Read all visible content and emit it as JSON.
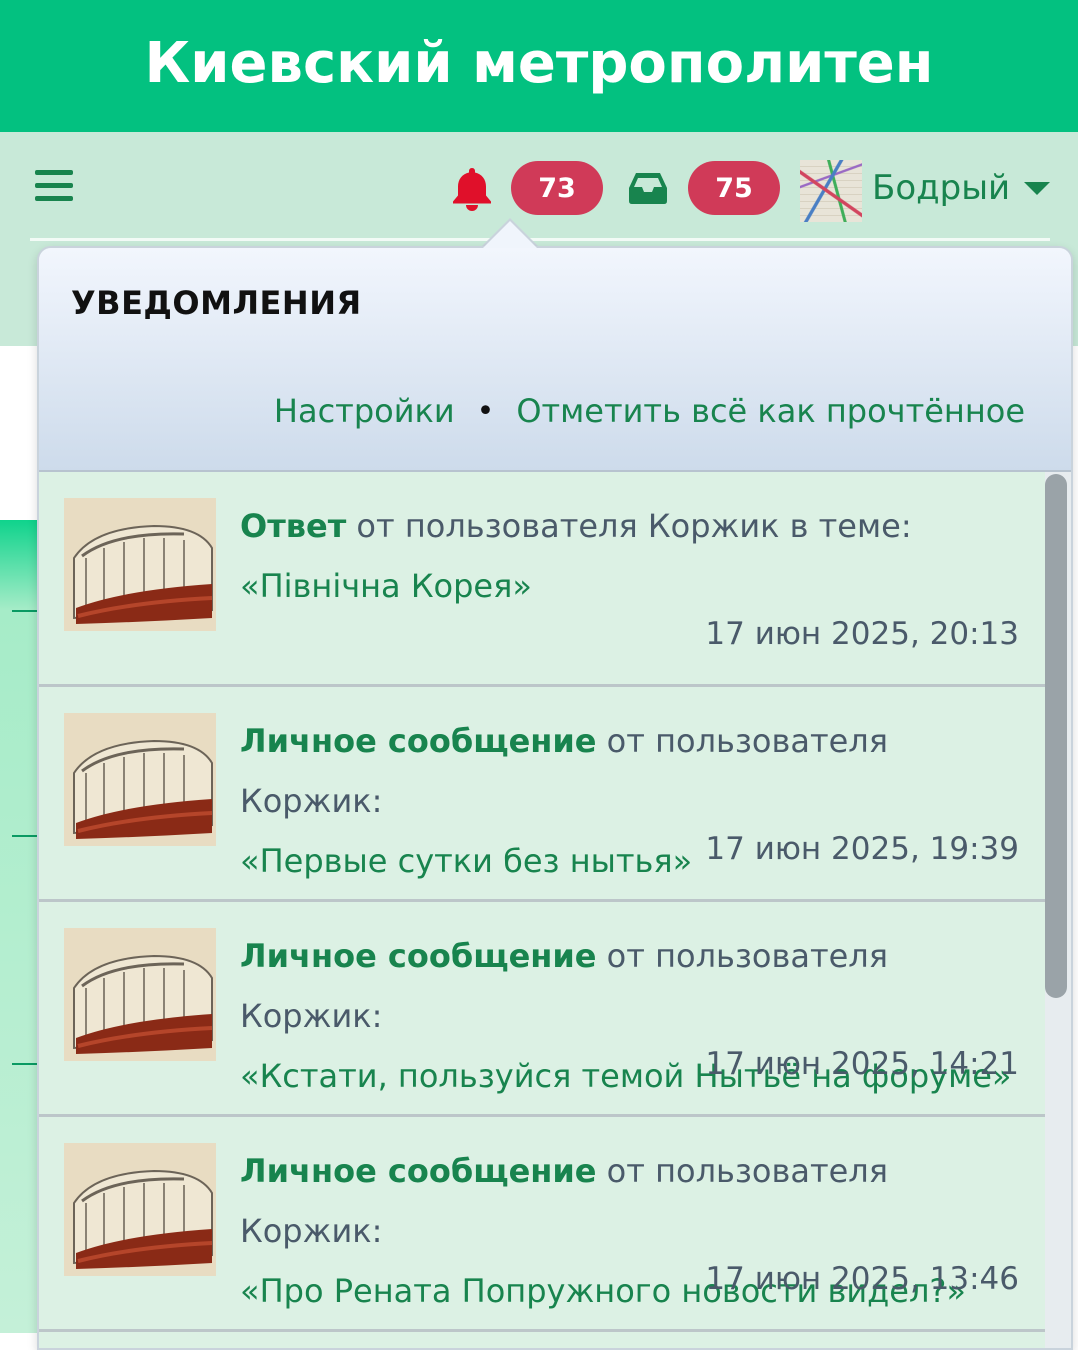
{
  "header": {
    "title": "Киевский метрополитен"
  },
  "navbar": {
    "notifications_count": "73",
    "inbox_count": "75",
    "username": "Бодрый"
  },
  "colors": {
    "brand_green": "#03c180",
    "link_green": "#18844e",
    "badge_red": "#d03a58",
    "bell_red": "#e0102a"
  },
  "icons": [
    "menu-icon",
    "bell-icon",
    "inbox-icon",
    "caret-down-icon"
  ],
  "popup": {
    "title": "УВЕДОМЛЕНИЯ",
    "settings_link": "Настройки",
    "separator": "•",
    "mark_all_read_link": "Отметить всё как прочтённое",
    "items": [
      {
        "kind": "Ответ",
        "mid": " от пользователя Коржик в теме:",
        "quote": "«Північна Корея»",
        "date": "17 июн 2025, 20:13"
      },
      {
        "kind": "Личное сообщение",
        "mid": " от пользователя Коржик:",
        "quote": "«Первые сутки без нытья»",
        "date": "17 июн 2025, 19:39"
      },
      {
        "kind": "Личное сообщение",
        "mid": " от пользователя Коржик:",
        "quote": "«Кстати, пользуйся темой Нытьё на форуме»",
        "date": "17 июн 2025, 14:21"
      },
      {
        "kind": "Личное сообщение",
        "mid": " от пользователя Коржик:",
        "quote": "«Про Рената Попружного новости видел?»",
        "date": "17 июн 2025, 13:46"
      }
    ]
  }
}
